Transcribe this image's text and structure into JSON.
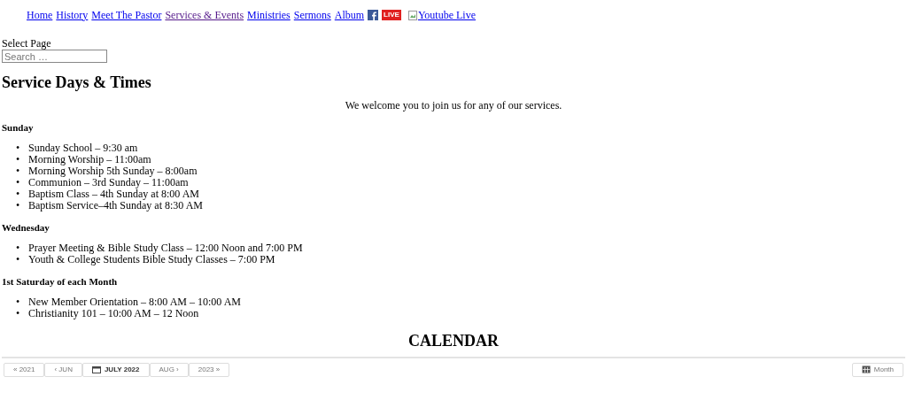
{
  "nav": {
    "links": [
      {
        "label": "Home",
        "visited": false
      },
      {
        "label": "History",
        "visited": false
      },
      {
        "label": "Meet The Pastor",
        "visited": false
      },
      {
        "label": "Services & Events",
        "visited": true
      },
      {
        "label": "Ministries",
        "visited": false
      },
      {
        "label": "Sermons",
        "visited": false
      },
      {
        "label": "Album",
        "visited": false
      }
    ],
    "live_badge": "LIVE",
    "broken_image_link": "Youtube Live"
  },
  "select_page": "Select Page",
  "search": {
    "placeholder": "Search …"
  },
  "title": "Service Days & Times",
  "intro": "We welcome you to join us for any of our services.",
  "list_marker": "•",
  "sections": [
    {
      "heading": "Sunday",
      "items": [
        "Sunday School – 9:30 am",
        "Morning Worship – 11:00am",
        "Morning Worship 5th Sunday – 8:00am",
        "Communion – 3rd Sunday – 11:00am",
        "Baptism Class – 4th Sunday at 8:00 AM",
        "Baptism Service–4th Sunday at 8:30 AM"
      ]
    },
    {
      "heading": "Wednesday",
      "items": [
        "Prayer Meeting & Bible Study Class – 12:00 Noon and 7:00 PM",
        "Youth & College Students Bible Study Classes – 7:00 PM"
      ]
    },
    {
      "heading": "1st Saturday of each Month",
      "items": [
        "New Member Orientation – 8:00 AM – 10:00 AM",
        "Christianity 101 – 10:00 AM – 12 Noon"
      ]
    }
  ],
  "calendar": {
    "heading": "CALENDAR",
    "nav_buttons": [
      {
        "label": "« 2021",
        "current": false
      },
      {
        "label": "‹ JUN",
        "current": false
      },
      {
        "label": "JULY 2022",
        "current": true
      },
      {
        "label": "AUG ›",
        "current": false
      },
      {
        "label": "2023 »",
        "current": false
      }
    ],
    "view_button": "Month"
  }
}
